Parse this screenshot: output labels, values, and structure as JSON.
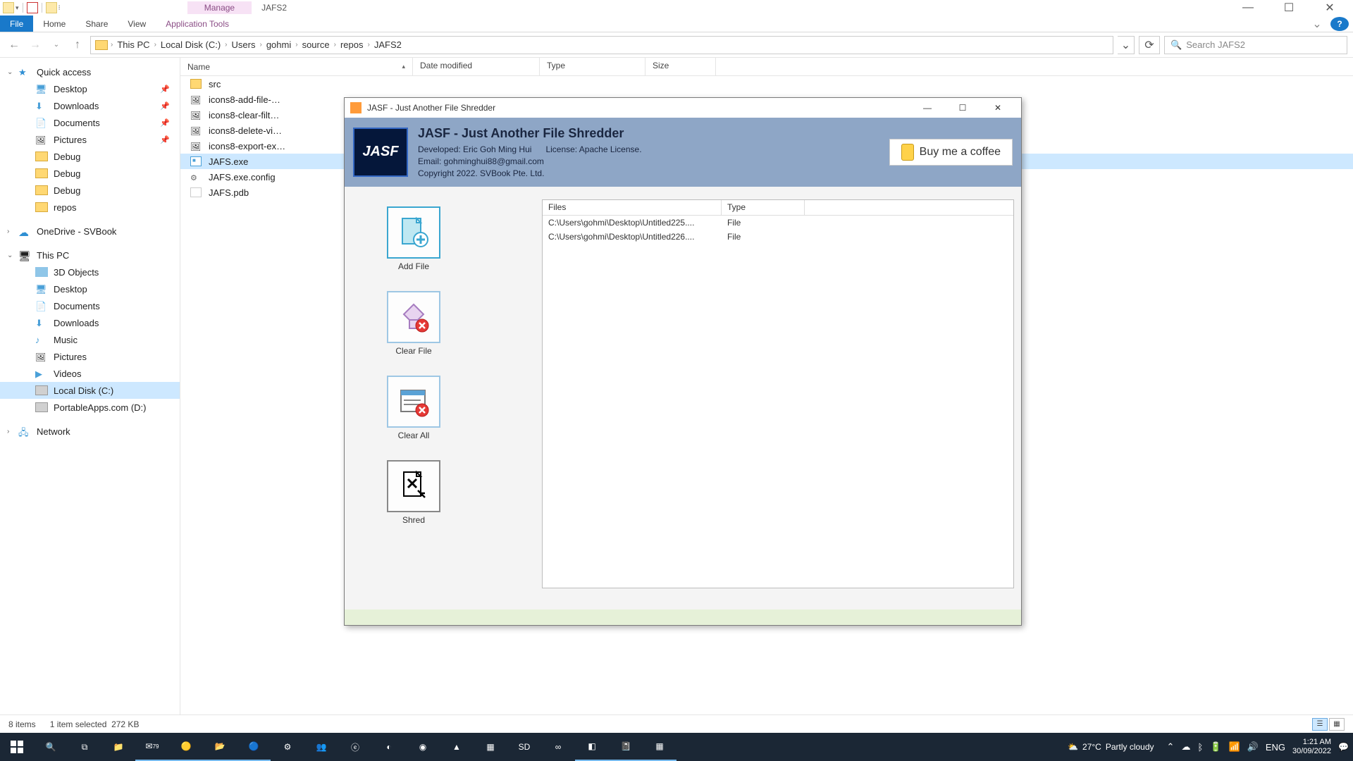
{
  "explorer": {
    "manage_tab": "Manage",
    "window_title": "JAFS2",
    "ribbon": {
      "file": "File",
      "home": "Home",
      "share": "Share",
      "view": "View",
      "apptools": "Application Tools"
    },
    "breadcrumbs": [
      "This PC",
      "Local Disk (C:)",
      "Users",
      "gohmi",
      "source",
      "repos",
      "JAFS2"
    ],
    "search_placeholder": "Search JAFS2",
    "columns": {
      "name": "Name",
      "date": "Date modified",
      "type": "Type",
      "size": "Size"
    },
    "files": [
      {
        "name": "src",
        "kind": "fldr"
      },
      {
        "name": "icons8-add-file-…",
        "kind": "img"
      },
      {
        "name": "icons8-clear-filt…",
        "kind": "img"
      },
      {
        "name": "icons8-delete-vi…",
        "kind": "img"
      },
      {
        "name": "icons8-export-ex…",
        "kind": "img"
      },
      {
        "name": "JAFS.exe",
        "kind": "exe",
        "selected": true
      },
      {
        "name": "JAFS.exe.config",
        "kind": "cfg"
      },
      {
        "name": "JAFS.pdb",
        "kind": "pdb"
      }
    ],
    "status_items": "8 items",
    "status_selected": "1 item selected",
    "status_size": "272 KB"
  },
  "sidebar": {
    "quick_access": "Quick access",
    "qa_items": [
      {
        "label": "Desktop",
        "pin": true,
        "ico": "desk"
      },
      {
        "label": "Downloads",
        "pin": true,
        "ico": "dl"
      },
      {
        "label": "Documents",
        "pin": true,
        "ico": "doc"
      },
      {
        "label": "Pictures",
        "pin": true,
        "ico": "pic"
      },
      {
        "label": "Debug",
        "pin": false,
        "ico": "folder"
      },
      {
        "label": "Debug",
        "pin": false,
        "ico": "folder"
      },
      {
        "label": "Debug",
        "pin": false,
        "ico": "folder"
      },
      {
        "label": "repos",
        "pin": false,
        "ico": "folder"
      }
    ],
    "onedrive": "OneDrive - SVBook",
    "this_pc": "This PC",
    "pc_items": [
      {
        "label": "3D Objects",
        "ico": "obj3d"
      },
      {
        "label": "Desktop",
        "ico": "desk"
      },
      {
        "label": "Documents",
        "ico": "doc"
      },
      {
        "label": "Downloads",
        "ico": "dl"
      },
      {
        "label": "Music",
        "ico": "mus"
      },
      {
        "label": "Pictures",
        "ico": "pic"
      },
      {
        "label": "Videos",
        "ico": "vid"
      },
      {
        "label": "Local Disk (C:)",
        "ico": "disk",
        "selected": true
      },
      {
        "label": "PortableApps.com (D:)",
        "ico": "disk"
      }
    ],
    "network": "Network"
  },
  "jasf": {
    "title": "JASF - Just Another File Shredder",
    "logo": "JASF",
    "banner_title": "JASF - Just Another File Shredder",
    "developed": "Developed: Eric Goh Ming Hui",
    "license": "License: Apache License.",
    "email": "Email: gohminghui88@gmail.com",
    "copyright": "Copyright 2022. SVBook Pte. Ltd.",
    "coffee": "Buy me a coffee",
    "buttons": {
      "add": "Add File",
      "clearfile": "Clear File",
      "clearall": "Clear All",
      "shred": "Shred"
    },
    "list": {
      "col_files": "Files",
      "col_type": "Type",
      "rows": [
        {
          "path": "C:\\Users\\gohmi\\Desktop\\Untitled225....",
          "type": "File"
        },
        {
          "path": "C:\\Users\\gohmi\\Desktop\\Untitled226....",
          "type": "File"
        }
      ]
    }
  },
  "taskbar": {
    "weather_temp": "27°C",
    "weather_text": "Partly cloudy",
    "lang": "ENG",
    "time": "1:21 AM",
    "date": "30/09/2022"
  }
}
